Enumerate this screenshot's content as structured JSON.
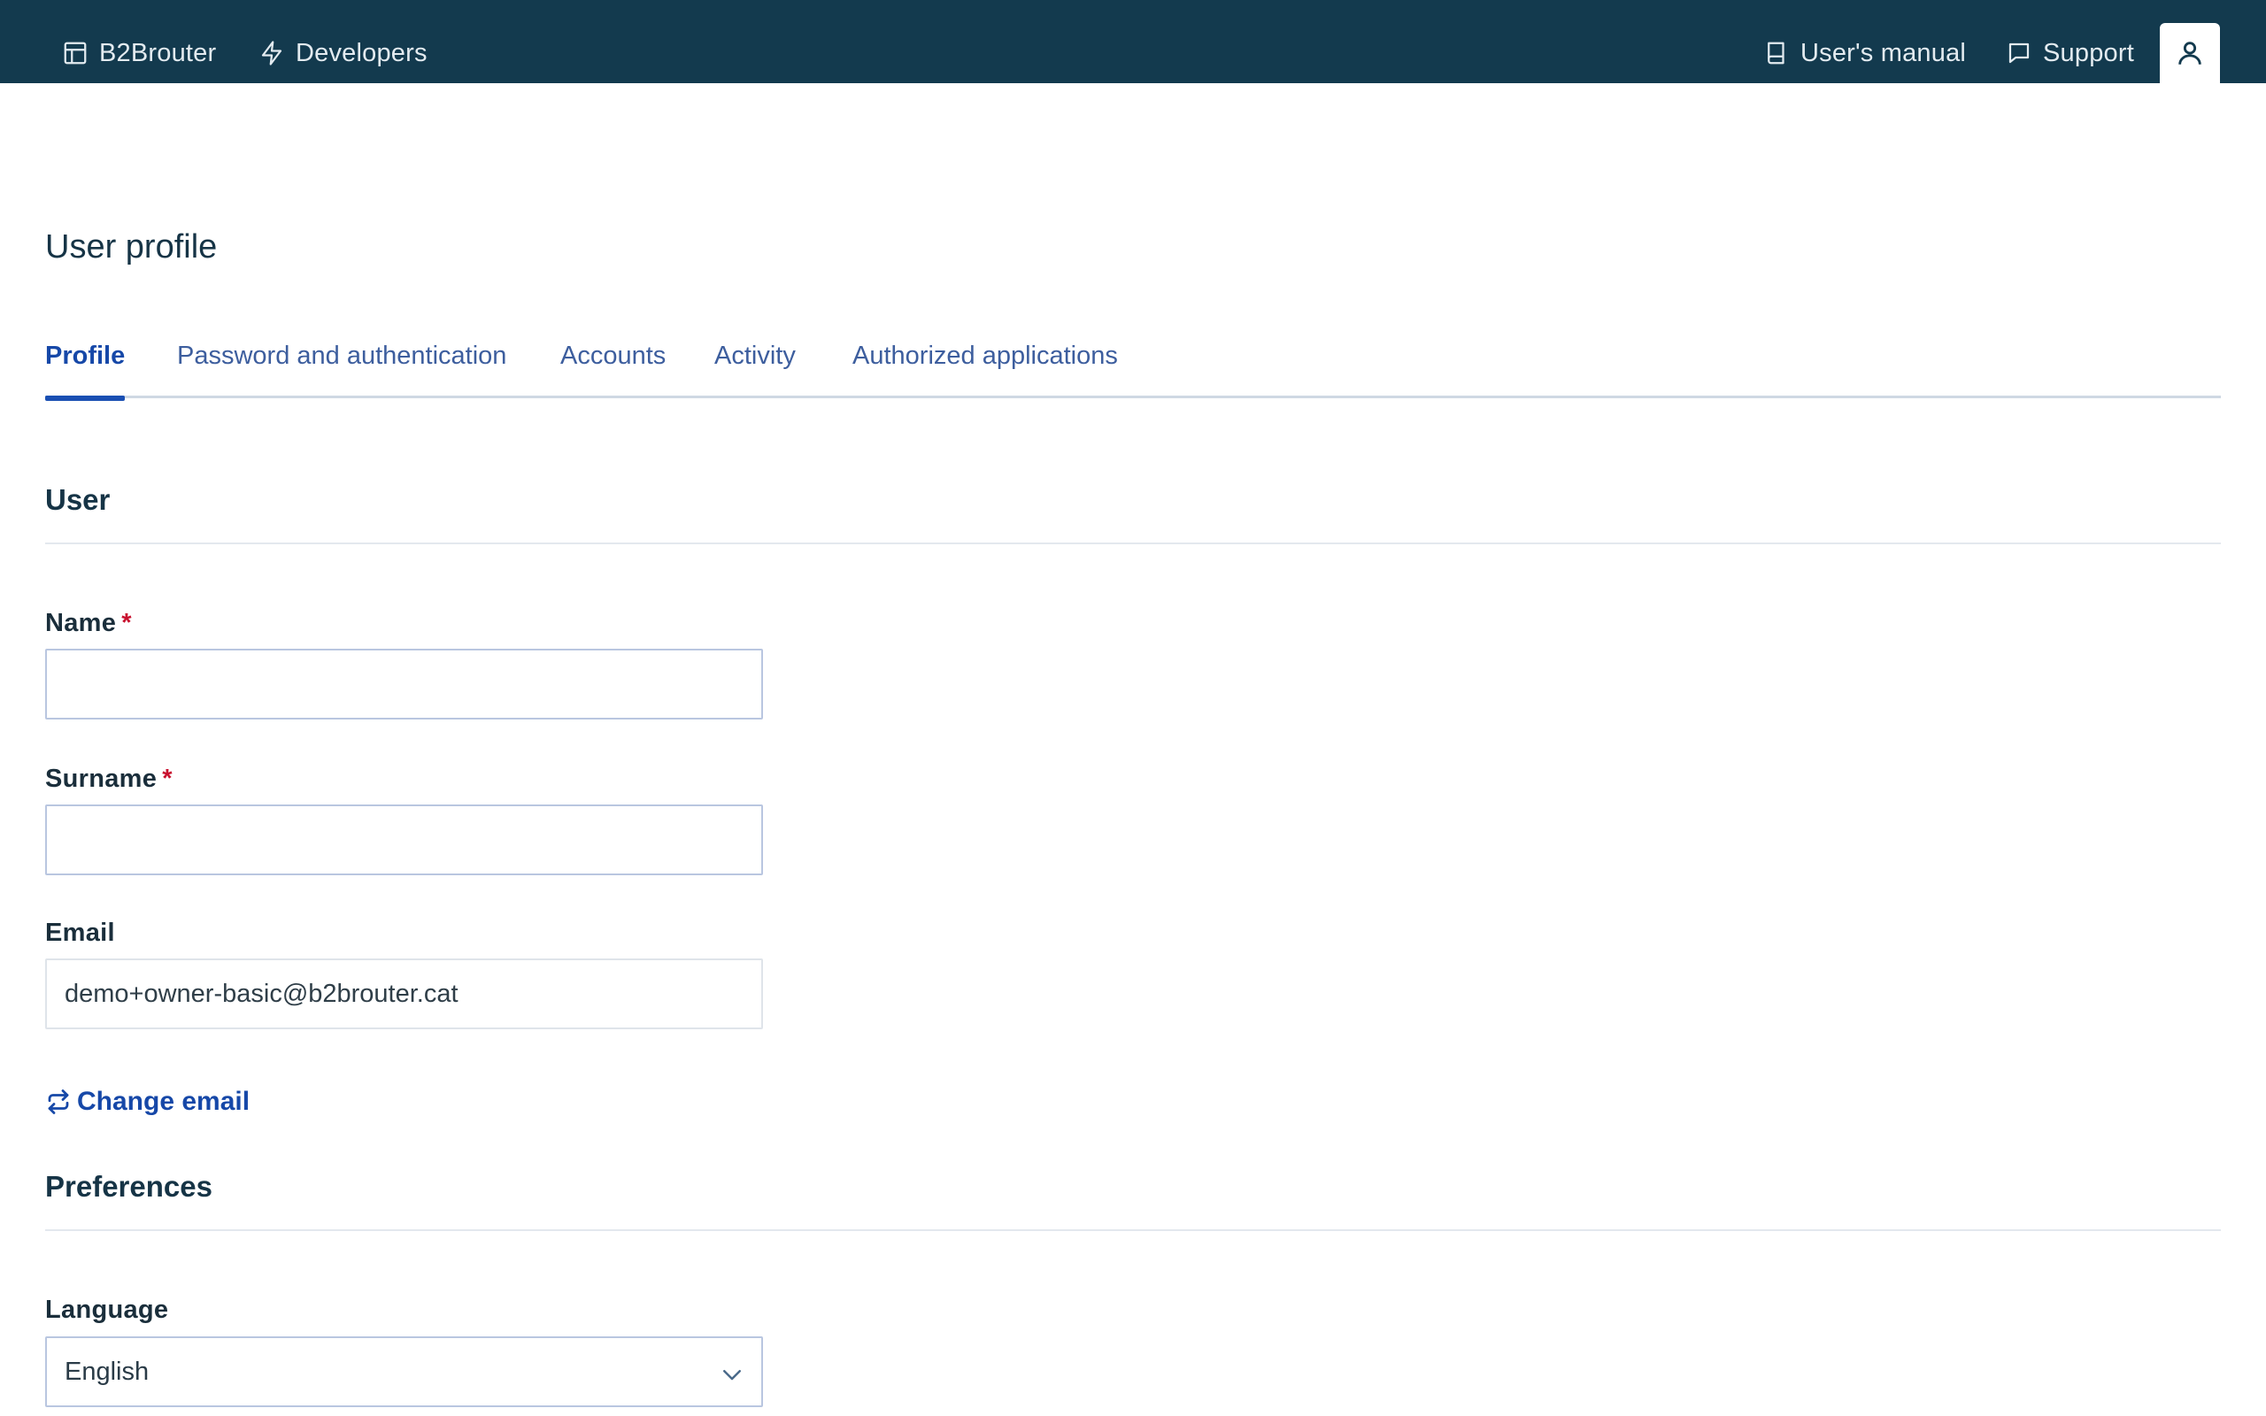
{
  "topbar": {
    "brand_label": "B2Brouter",
    "developers_label": "Developers",
    "manual_label": "User's manual",
    "support_label": "Support",
    "icons": [
      "layout-icon",
      "lightning-icon",
      "book-icon",
      "chat-icon",
      "user-icon"
    ],
    "background": "#133a4e"
  },
  "page": {
    "title": "User profile"
  },
  "tabs": [
    {
      "label": "Profile",
      "active": true
    },
    {
      "label": "Password and authentication",
      "active": false
    },
    {
      "label": "Accounts",
      "active": false
    },
    {
      "label": "Activity",
      "active": false
    },
    {
      "label": "Authorized applications",
      "active": false
    }
  ],
  "user_section": {
    "title": "User",
    "name_label": "Name",
    "name_value": "",
    "surname_label": "Surname",
    "surname_value": "",
    "required_mark": "*",
    "email_label": "Email",
    "email_value": "demo+owner-basic@b2brouter.cat",
    "change_email_label": "Change email"
  },
  "preferences_section": {
    "title": "Preferences",
    "language_label": "Language",
    "language_value": "English"
  },
  "colors": {
    "accent": "#1648a8",
    "required": "#c8102e"
  }
}
